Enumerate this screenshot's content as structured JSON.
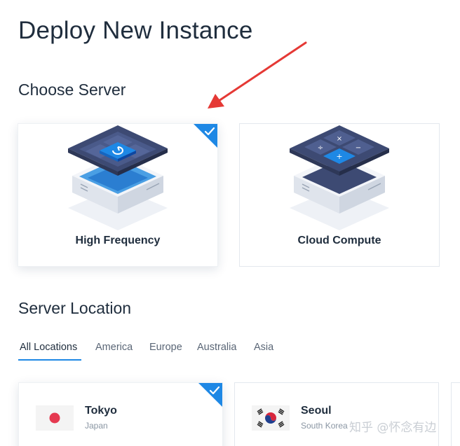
{
  "page": {
    "title": "Deploy New Instance"
  },
  "choose_server": {
    "title": "Choose Server",
    "options": [
      {
        "label": "High Frequency",
        "selected": true,
        "icon": "high-frequency-server-icon"
      },
      {
        "label": "Cloud Compute",
        "selected": false,
        "icon": "cloud-compute-server-icon"
      }
    ]
  },
  "server_location": {
    "title": "Server Location",
    "tabs": [
      {
        "label": "All Locations",
        "active": true
      },
      {
        "label": "America",
        "active": false
      },
      {
        "label": "Europe",
        "active": false
      },
      {
        "label": "Australia",
        "active": false
      },
      {
        "label": "Asia",
        "active": false
      }
    ],
    "locations": [
      {
        "city": "Tokyo",
        "country": "Japan",
        "selected": true,
        "flag": "japan-flag-icon"
      },
      {
        "city": "Seoul",
        "country": "South Korea",
        "selected": false,
        "flag": "south-korea-flag-icon"
      }
    ]
  },
  "watermark": "知乎 @怀念有边",
  "colors": {
    "accent": "#1e88e5",
    "annotation_arrow": "#e53935",
    "text_primary": "#1f2d3d",
    "text_secondary": "#8a96a3"
  }
}
